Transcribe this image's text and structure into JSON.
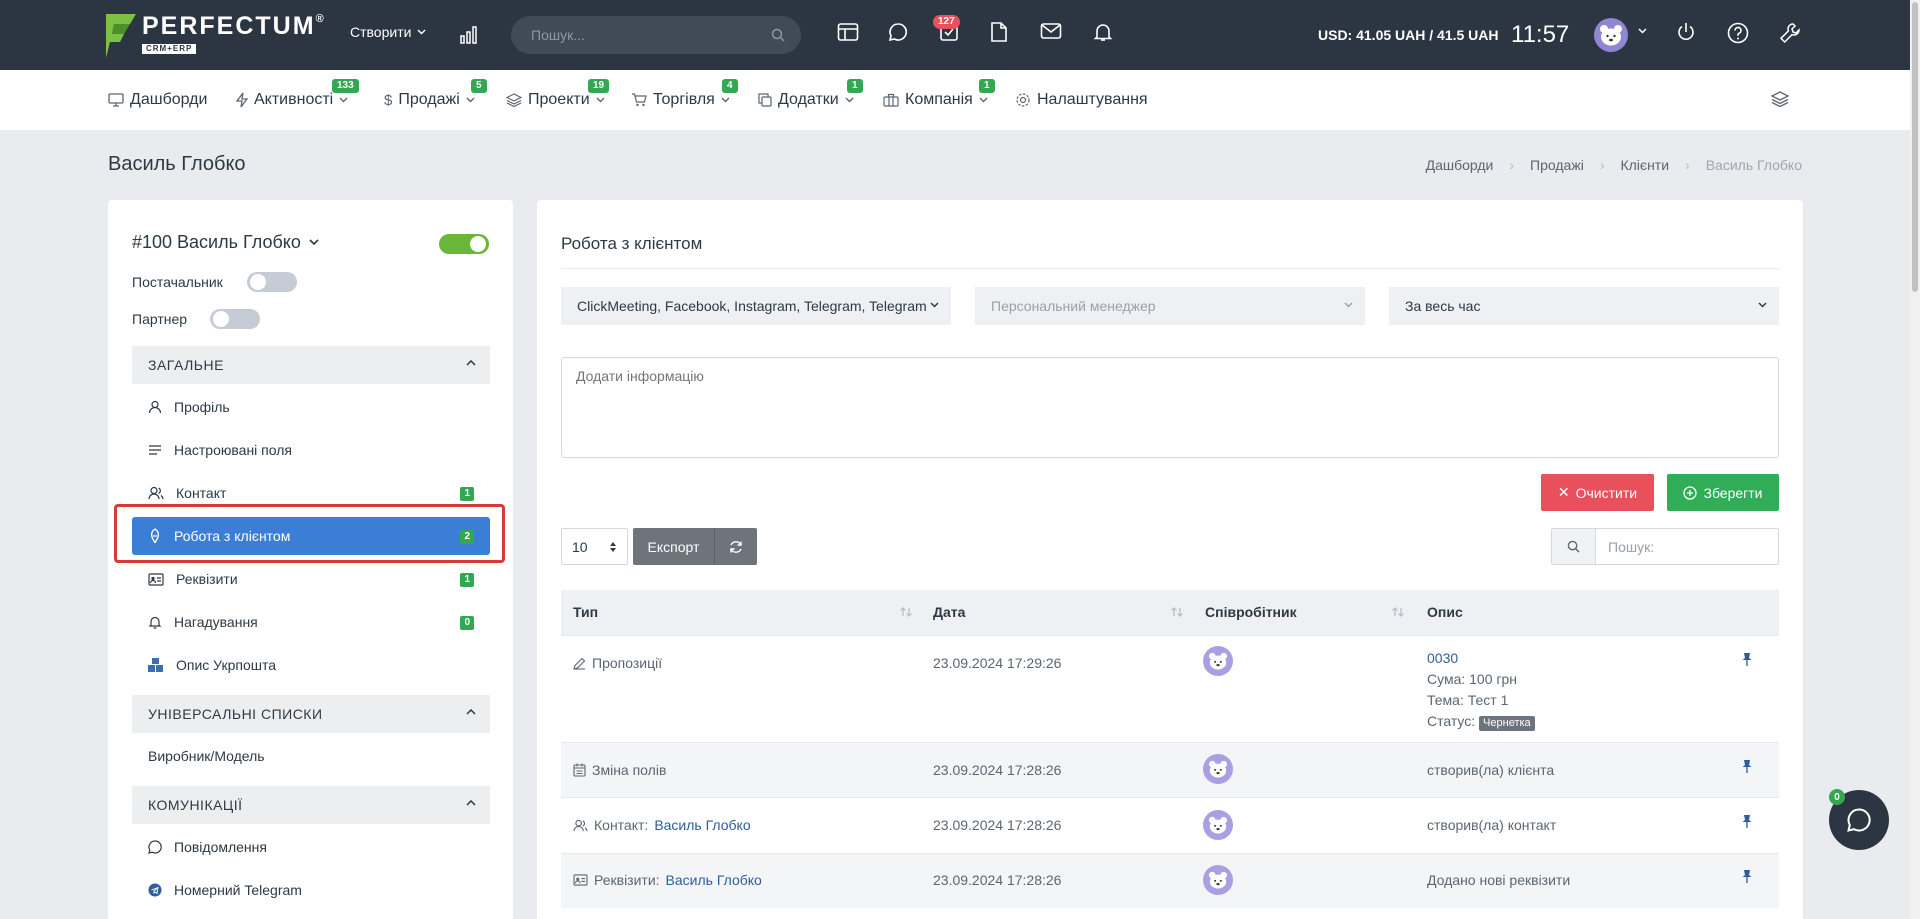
{
  "topbar": {
    "logo_name": "PERFECTUM",
    "logo_reg": "®",
    "logo_sub": "CRM+ERP",
    "create_label": "Створити",
    "search_placeholder": "Пошук...",
    "tasks_badge": "127",
    "currency": "USD: 41.05 UAH / 41.5 UAH",
    "time": "11:57",
    "icons": [
      "chart-icon",
      "table-icon",
      "chat-icon",
      "tasks-icon",
      "document-icon",
      "mail-icon",
      "bell-icon",
      "power-icon",
      "help-icon",
      "wrench-icon"
    ]
  },
  "nav": {
    "items": [
      {
        "label": "Дашборди",
        "badge": ""
      },
      {
        "label": "Активності",
        "badge": "133"
      },
      {
        "label": "Продажі",
        "badge": "5"
      },
      {
        "label": "Проекти",
        "badge": "19"
      },
      {
        "label": "Торгівля",
        "badge": "4"
      },
      {
        "label": "Додатки",
        "badge": "1"
      },
      {
        "label": "Компанія",
        "badge": "1"
      },
      {
        "label": "Налаштування",
        "badge": ""
      }
    ]
  },
  "page": {
    "title": "Василь Глобко",
    "breadcrumb": [
      "Дашборди",
      "Продажі",
      "Клієнти",
      "Василь Глобко"
    ]
  },
  "sidebar": {
    "client_title": "#100 Василь Глобко",
    "supplier_label": "Постачальник",
    "partner_label": "Партнер",
    "active_toggle_on": true,
    "supplier_toggle_on": false,
    "partner_toggle_on": false,
    "sections": [
      {
        "title": "ЗАГАЛЬНЕ"
      },
      {
        "title": "УНІВЕРСАЛЬНІ СПИСКИ"
      },
      {
        "title": "КОМУНІКАЦІЇ"
      }
    ],
    "general_items": [
      {
        "label": "Профіль",
        "count": "",
        "icon": "user-icon"
      },
      {
        "label": "Настроювані поля",
        "count": "",
        "icon": "lines-icon"
      },
      {
        "label": "Контакт",
        "count": "1",
        "icon": "users-icon"
      },
      {
        "label": "Робота з клієнтом",
        "count": "2",
        "icon": "handshake-icon",
        "active": true
      },
      {
        "label": "Реквізити",
        "count": "1",
        "icon": "id-card-icon"
      },
      {
        "label": "Нагадування",
        "count": "0",
        "icon": "bell-icon"
      },
      {
        "label": "Опис Укрпошта",
        "count": "",
        "icon": "boxes-icon"
      }
    ],
    "lists_items": [
      {
        "label": "Виробник/Модель"
      }
    ],
    "comm_items": [
      {
        "label": "Повідомлення",
        "icon": "chat-icon"
      },
      {
        "label": "Номерний Telegram",
        "icon": "telegram-icon"
      }
    ]
  },
  "main": {
    "title": "Робота з клієнтом",
    "filters": {
      "sources": "ClickMeeting, Facebook, Instagram, Telegram, Telegram",
      "manager_placeholder": "Персональний менеджер",
      "period": "За весь час"
    },
    "info_placeholder": "Додати інформацію",
    "clear_label": "Очистити",
    "save_label": "Зберегти",
    "page_size": "10",
    "export_label": "Експорт",
    "search_placeholder": "Пошук:",
    "columns": [
      "Тип",
      "Дата",
      "Співробітник",
      "Опис"
    ],
    "rows": [
      {
        "type_text": "Пропозиції",
        "type_link": "",
        "type_icon": "pencil-icon",
        "date": "23.09.2024 17:29:26",
        "desc_link": "0030",
        "desc_lines": [
          "Сума: 100 грн",
          "Тема: Тест 1"
        ],
        "status_label": "Статус:",
        "status_badge": "Чернетка"
      },
      {
        "type_text": "Зміна полів",
        "type_link": "",
        "type_icon": "calendar-icon",
        "date": "23.09.2024 17:28:26",
        "desc": "створив(ла) клієнта"
      },
      {
        "type_text": "Контакт:",
        "type_link": "Василь Глобко",
        "type_icon": "users-icon",
        "date": "23.09.2024 17:28:26",
        "desc": "створив(ла) контакт"
      },
      {
        "type_text": "Реквізити:",
        "type_link": "Василь Глобко",
        "type_icon": "id-card-icon",
        "date": "23.09.2024 17:28:26",
        "desc": "Додано нові реквізити"
      }
    ]
  },
  "chat": {
    "badge": "0"
  },
  "colors": {
    "topbar": "#2c3642",
    "accent_blue": "#3a7fd5",
    "badge_green": "#33a852",
    "danger": "#e8505b",
    "success": "#2fae57",
    "toggle_on": "#6bb739"
  }
}
